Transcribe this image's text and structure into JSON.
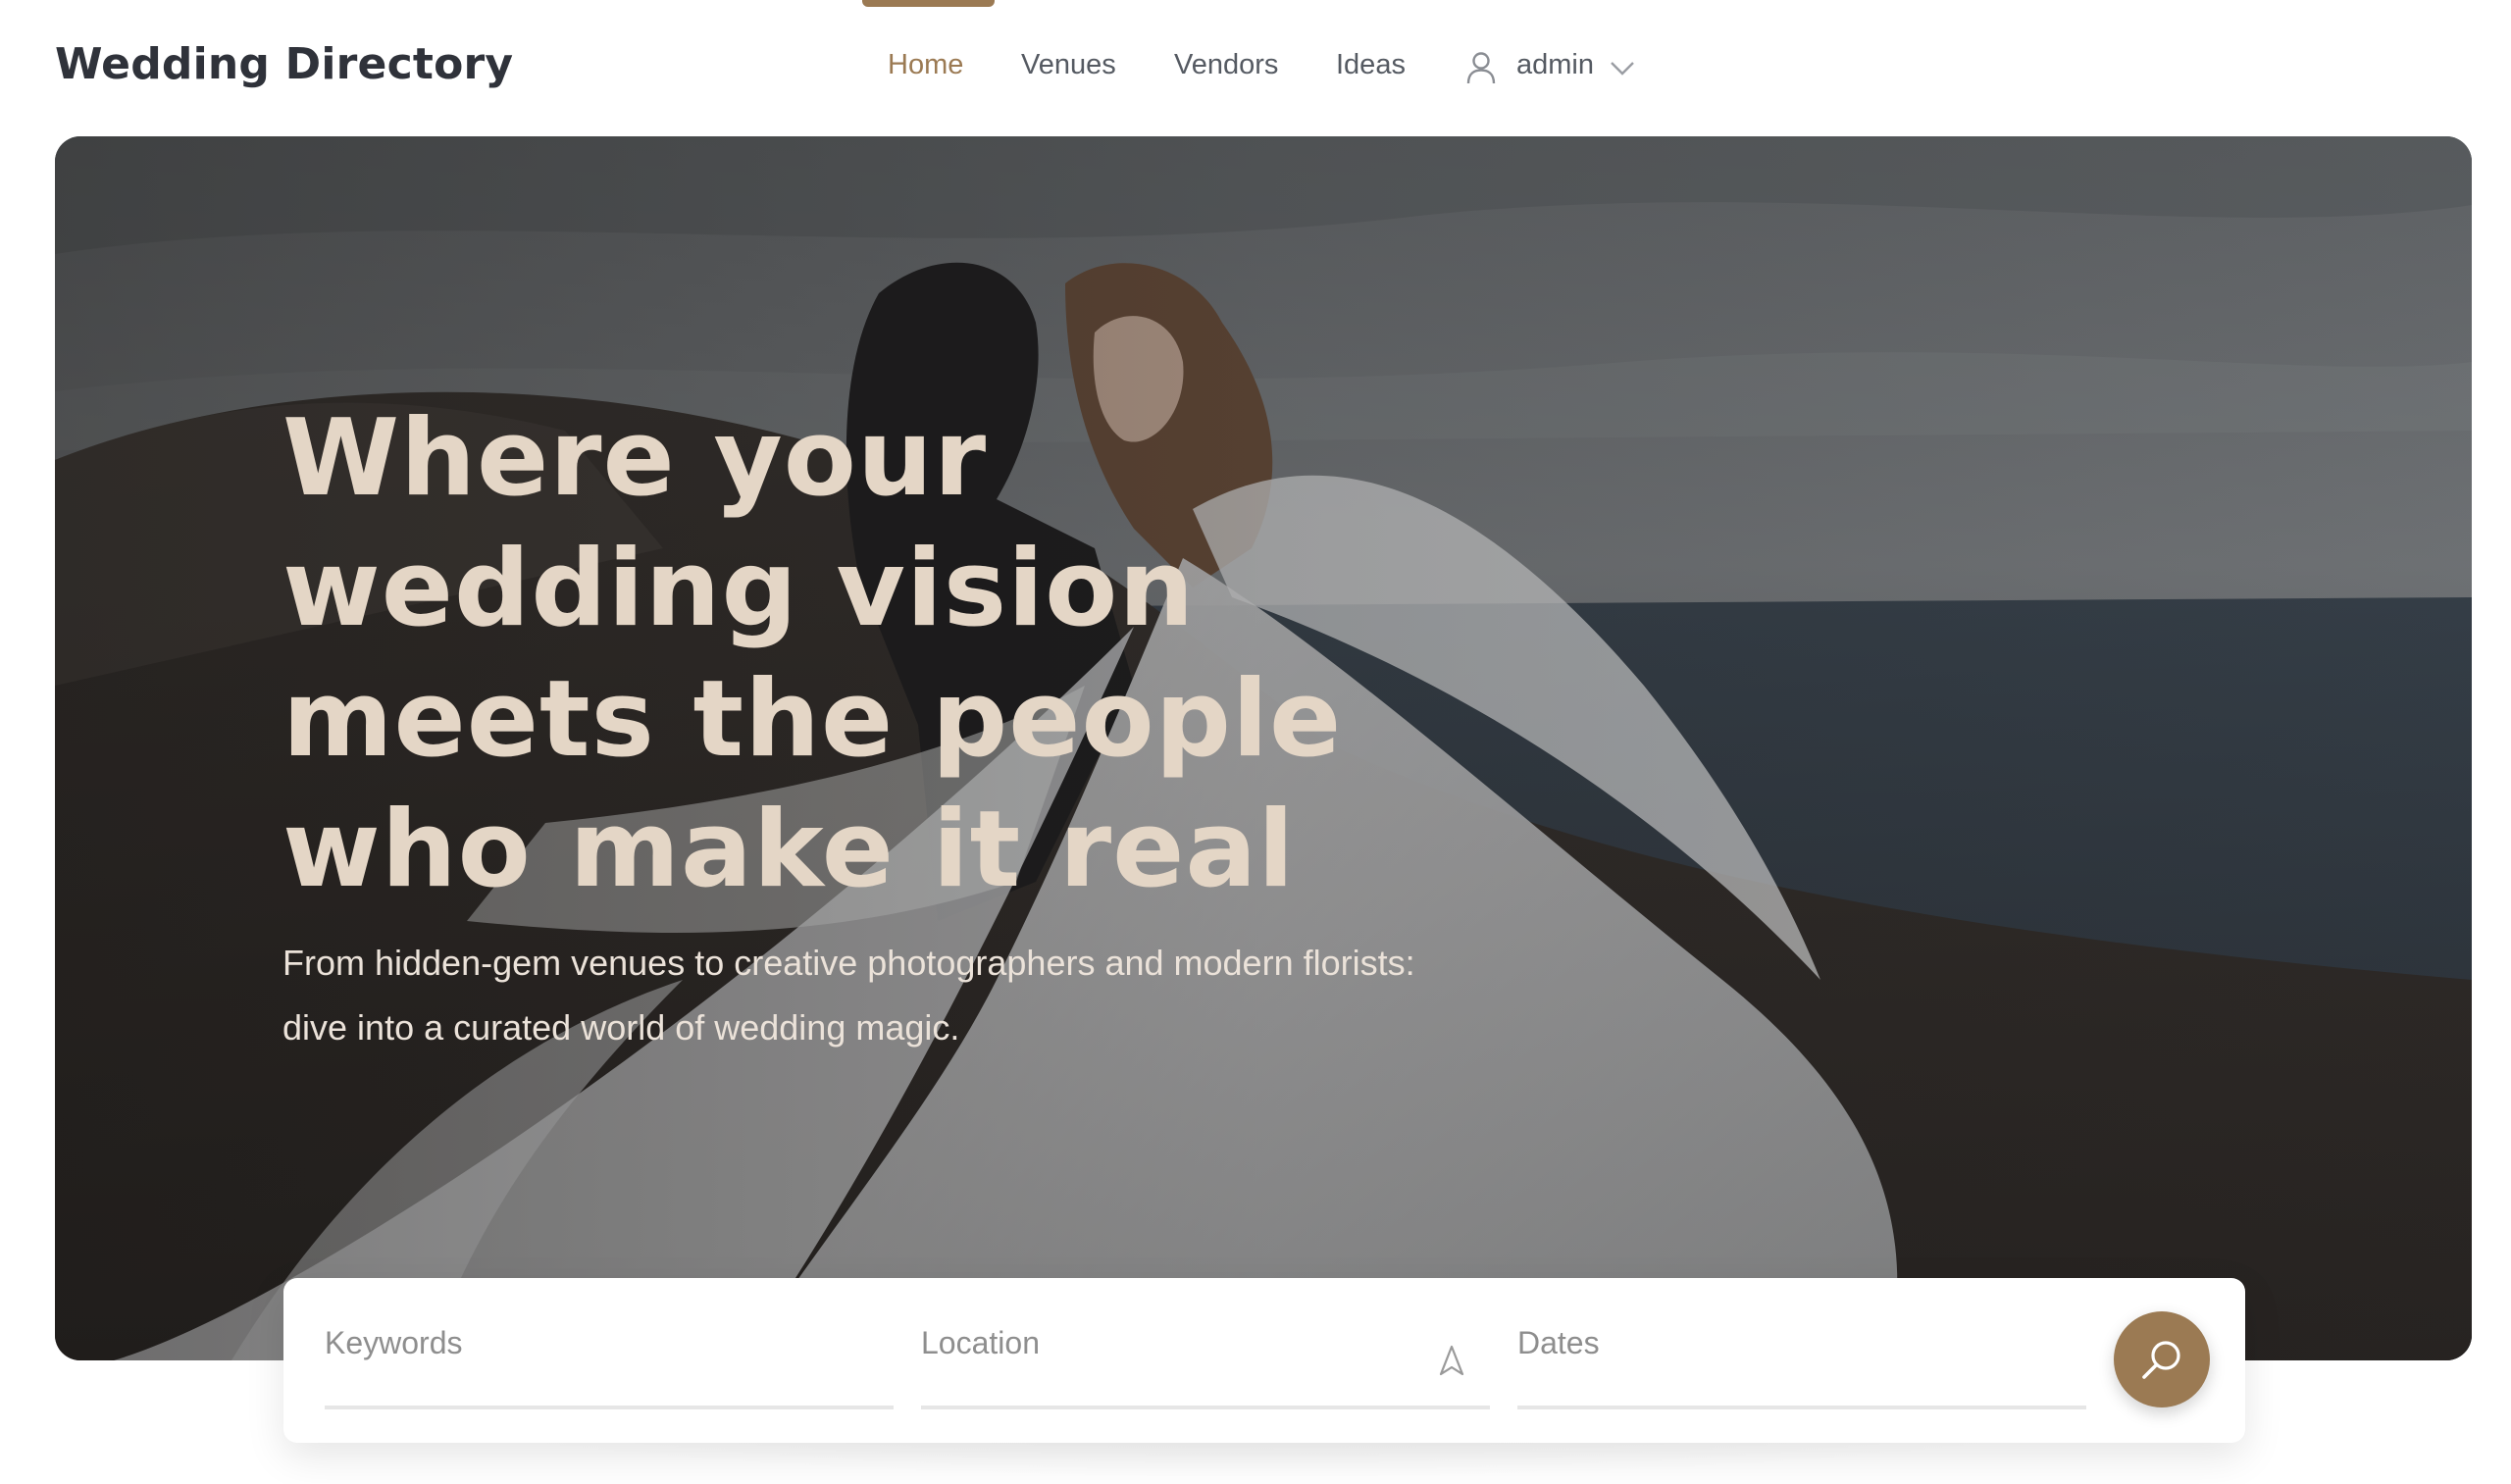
{
  "header": {
    "brand": "Wedding Directory",
    "nav": [
      {
        "label": "Home",
        "active": true
      },
      {
        "label": "Venues",
        "active": false
      },
      {
        "label": "Vendors",
        "active": false
      },
      {
        "label": "Ideas",
        "active": false
      }
    ],
    "user": {
      "name": "admin",
      "icon": "user-icon",
      "menu_icon": "chevron-down-icon"
    }
  },
  "hero": {
    "headline": "Where your wedding vision meets the people who make it real",
    "subhead": "From hidden-gem venues to creative photographers and modern florists: dive into a curated world of wedding magic."
  },
  "search": {
    "keywords_placeholder": "Keywords",
    "location_placeholder": "Location",
    "dates_placeholder": "Dates",
    "location_icon": "navigation-arrow-icon",
    "button_icon": "search-icon"
  },
  "colors": {
    "accent": "#9b7a53",
    "headline": "#e4d6c6",
    "brand_text": "#2f323a"
  }
}
